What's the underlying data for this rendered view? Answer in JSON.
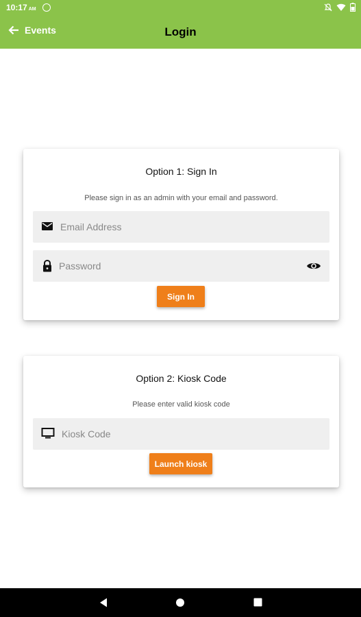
{
  "status_bar": {
    "time": "10:17",
    "ampm": "AM"
  },
  "app_bar": {
    "back_label": "Events",
    "title": "Login"
  },
  "sign_in_card": {
    "title": "Option 1: Sign In",
    "subtitle": "Please sign in as an admin with your email and password.",
    "email_placeholder": "Email Address",
    "password_placeholder": "Password",
    "button_label": "Sign In"
  },
  "kiosk_card": {
    "title": "Option 2: Kiosk Code",
    "subtitle": "Please enter valid kiosk code",
    "kiosk_placeholder": "Kiosk Code",
    "button_label": "Launch kiosk"
  },
  "colors": {
    "app_bar": "#8bc34a",
    "button": "#ef7f1a",
    "field": "#efefef"
  },
  "icons": [
    "back-arrow-icon",
    "mail-icon",
    "lock-icon",
    "eye-icon",
    "monitor-icon",
    "nav-back-icon",
    "nav-home-icon",
    "nav-recents-icon"
  ]
}
